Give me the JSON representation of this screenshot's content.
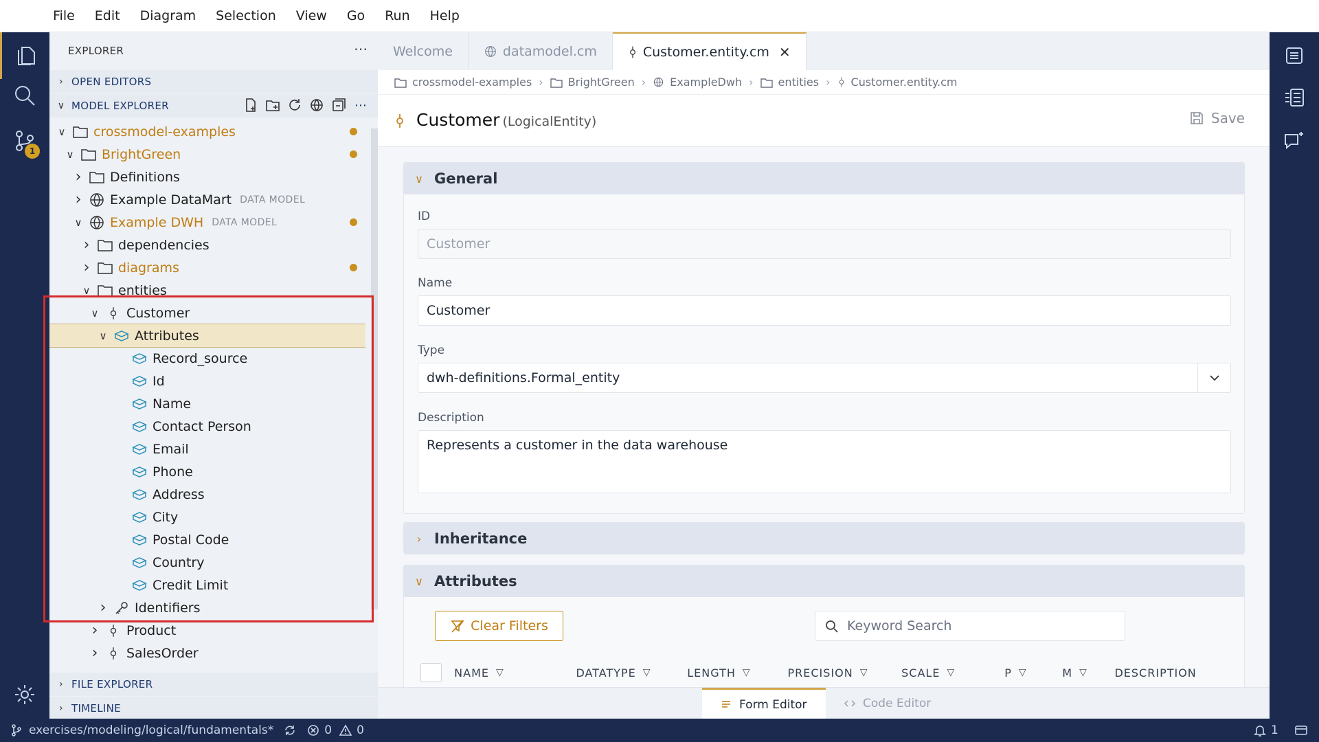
{
  "menu": [
    "File",
    "Edit",
    "Diagram",
    "Selection",
    "View",
    "Go",
    "Run",
    "Help"
  ],
  "activity": {
    "scm_badge": "1"
  },
  "explorer": {
    "title": "EXPLORER",
    "more": "⋯",
    "sections": {
      "open_editors": "OPEN EDITORS",
      "model_explorer": "MODEL EXPLORER",
      "file_explorer": "FILE EXPLORER",
      "timeline": "TIMELINE"
    },
    "tree": [
      {
        "label": "crossmodel-examples",
        "kind": "folder",
        "expanded": true,
        "modified": true
      },
      {
        "label": "BrightGreen",
        "kind": "folder",
        "expanded": true,
        "modified": true
      },
      {
        "label": "Definitions",
        "kind": "folder",
        "expanded": false
      },
      {
        "label": "Example DataMart",
        "kind": "globe",
        "expanded": false,
        "tag": "DATA MODEL"
      },
      {
        "label": "Example DWH",
        "kind": "globe",
        "expanded": true,
        "tag": "DATA MODEL",
        "modified": true
      },
      {
        "label": "dependencies",
        "kind": "folder",
        "expanded": false
      },
      {
        "label": "diagrams",
        "kind": "folder",
        "expanded": false,
        "modified": true
      },
      {
        "label": "entities",
        "kind": "folder",
        "expanded": true
      },
      {
        "label": "Customer",
        "kind": "entity",
        "expanded": true
      },
      {
        "label": "Attributes",
        "kind": "attr",
        "expanded": true,
        "selected": true
      },
      {
        "label": "Record_source",
        "kind": "attr"
      },
      {
        "label": "Id",
        "kind": "attr"
      },
      {
        "label": "Name",
        "kind": "attr"
      },
      {
        "label": "Contact Person",
        "kind": "attr"
      },
      {
        "label": "Email",
        "kind": "attr"
      },
      {
        "label": "Phone",
        "kind": "attr"
      },
      {
        "label": "Address",
        "kind": "attr"
      },
      {
        "label": "City",
        "kind": "attr"
      },
      {
        "label": "Postal Code",
        "kind": "attr"
      },
      {
        "label": "Country",
        "kind": "attr"
      },
      {
        "label": "Credit Limit",
        "kind": "attr"
      },
      {
        "label": "Identifiers",
        "kind": "key",
        "expanded": false
      },
      {
        "label": "Product",
        "kind": "entity",
        "expanded": false
      },
      {
        "label": "SalesOrder",
        "kind": "entity",
        "expanded": false
      }
    ]
  },
  "tabs": [
    {
      "label": "Welcome",
      "icon": "none",
      "active": false
    },
    {
      "label": "datamodel.cm",
      "icon": "globe-icon",
      "active": false
    },
    {
      "label": "Customer.entity.cm",
      "icon": "entity-icon",
      "active": true,
      "close": "✕"
    }
  ],
  "breadcrumbs": [
    "crossmodel-examples",
    "BrightGreen",
    "ExampleDwh",
    "entities",
    "Customer.entity.cm"
  ],
  "editor": {
    "title": "Customer",
    "subtitle": "(LogicalEntity)",
    "save_label": "Save",
    "general": {
      "header": "General",
      "id_label": "ID",
      "id_value": "Customer",
      "name_label": "Name",
      "name_value": "Customer",
      "type_label": "Type",
      "type_value": "dwh-definitions.Formal_entity",
      "description_label": "Description",
      "description_value": "Represents a customer in the data warehouse"
    },
    "inheritance_header": "Inheritance",
    "attributes": {
      "header": "Attributes",
      "clear_filters": "Clear Filters",
      "search_placeholder": "Keyword Search",
      "columns": [
        "NAME",
        "DATATYPE",
        "LENGTH",
        "PRECISION",
        "SCALE",
        "P",
        "M",
        "DESCRIPTION"
      ]
    }
  },
  "bottom_tabs": {
    "form": "Form Editor",
    "code": "Code Editor"
  },
  "status": {
    "branch": "exercises/modeling/logical/fundamentals*",
    "errors": "0",
    "warnings": "0",
    "notifications": "1"
  },
  "colors": {
    "accent": "#d4a64a",
    "modified": "#c8901c",
    "activity_bg": "#1b2a4e",
    "selection": "#f1e6c8",
    "highlight_box": "#d62b2b"
  }
}
